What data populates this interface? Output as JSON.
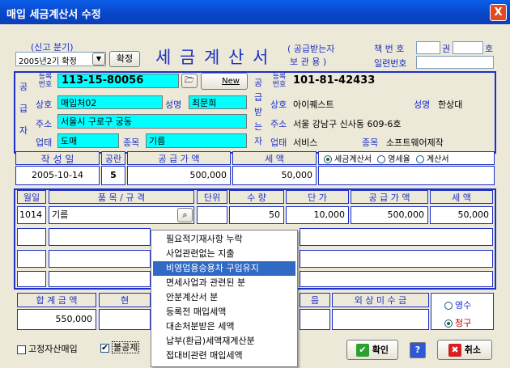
{
  "window": {
    "title": "매입 세금계산서 수정",
    "close": "X"
  },
  "period": {
    "label": "(신고 분기)",
    "value": "2005년2기 확정",
    "confirm": "확정"
  },
  "doc": {
    "title": "세 금 계 산 서",
    "sub1": "( 공급받는자",
    "sub2": "보 관 용 )",
    "book_label": "책 번 호",
    "kwon": "권",
    "ho": "호",
    "serial_label": "일련번호"
  },
  "supplier": {
    "side_label": [
      "공",
      "급",
      "자"
    ],
    "reg_label": "등록\n번호",
    "reg_no": "113-15-80056",
    "new_label": "New",
    "company_label": "상호",
    "company": "매입처02",
    "name_label": "성명",
    "name": "최문희",
    "addr_label": "주소",
    "addr": "서울시 구로구 궁동",
    "biz_label": "업태",
    "biz": "도매",
    "item_label": "종목",
    "item": "기름"
  },
  "receiver": {
    "side_label": [
      "공",
      "급",
      "받",
      "는",
      "자"
    ],
    "reg_label": "등록\n번호",
    "reg_no": "101-81-42433",
    "company_label": "상호",
    "company": "아이퀘스트",
    "name_label": "성명",
    "name": "한상대",
    "addr_label": "주소",
    "addr": "서울 강남구 신사동 609-6호",
    "biz_label": "업태",
    "biz": "서비스",
    "item_label": "종목",
    "item": "소프트웨어제작"
  },
  "summary": {
    "date_label": "작 성 일",
    "date": "2005-10-14",
    "blank_label": "공란",
    "blank": "5",
    "supply_label": "공 급 가 액",
    "supply": "500,000",
    "tax_label": "세 액",
    "tax": "50,000",
    "types": [
      "세금계산서",
      "영세율",
      "계산서"
    ]
  },
  "items": {
    "headers": [
      "월일",
      "품 목 / 규 격",
      "단위",
      "수 량",
      "단 가",
      "공 급 가 액",
      "세 액"
    ],
    "rows": [
      {
        "date": "1014",
        "name": "기름",
        "unit": "",
        "qty": "50",
        "price": "10,000",
        "supply": "500,000",
        "tax": "50,000"
      }
    ]
  },
  "totals": {
    "total_label": "합 계 금 액",
    "total": "550,000",
    "cash_label": "현",
    "bill_label": "음",
    "credit_label": "외 상 미 수 금",
    "receipt": "영수",
    "claim": "청구"
  },
  "context_menu": [
    "필요적기재사항 누락",
    "사업관련없는 지출",
    "비영업용승용차 구입유지",
    "면세사업과 관련된 분",
    "안분계산서 분",
    "등록전 매입세액",
    "대손처분받은 세액",
    "납부(환급)세액재계산분",
    "접대비관련 매입세액"
  ],
  "bottom": {
    "fixed_asset": "고정자산매입",
    "non_deduct": "불공제",
    "ok": "확인",
    "help": "?",
    "cancel": "취소"
  }
}
